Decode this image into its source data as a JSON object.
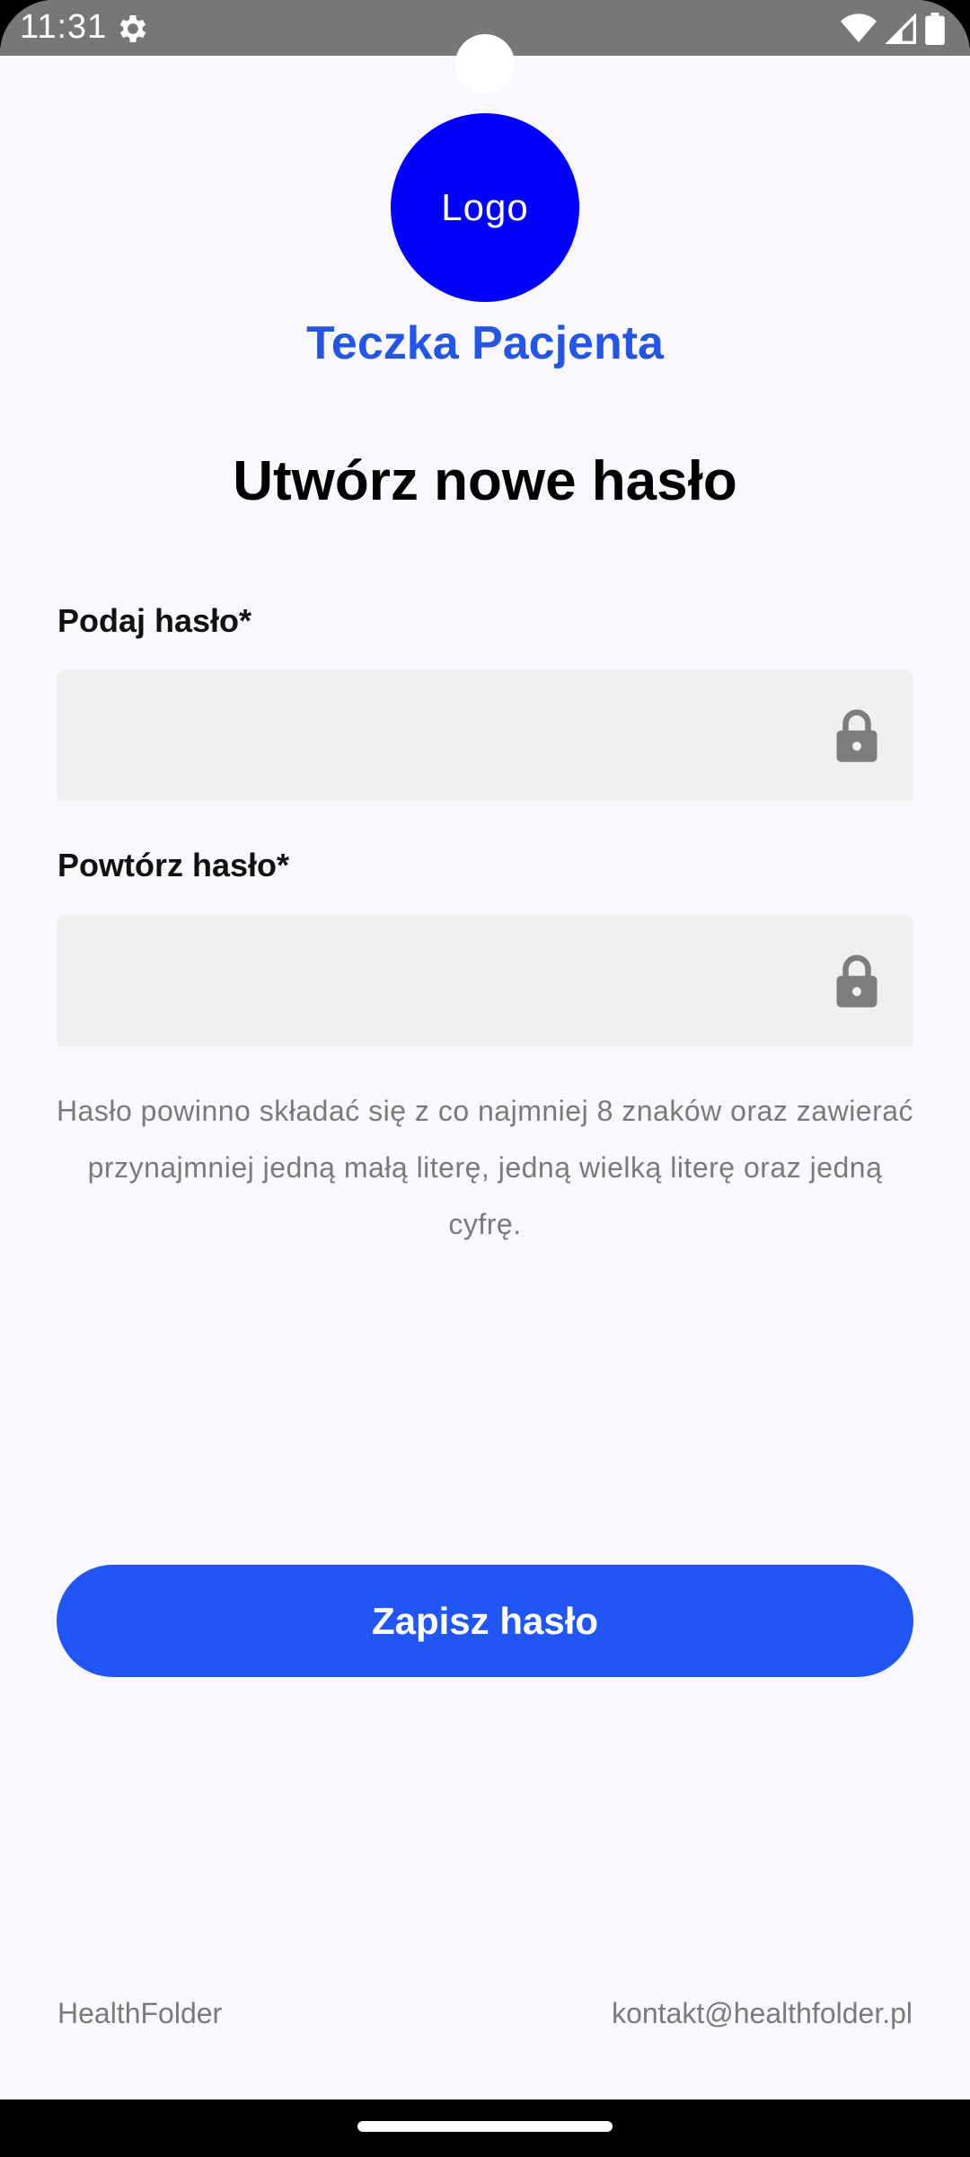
{
  "status_bar": {
    "time": "11:31",
    "icons": [
      "gear-icon",
      "wifi-icon",
      "signal-icon",
      "battery-icon"
    ]
  },
  "logo": {
    "label": "Logo",
    "color": "#0000ff"
  },
  "app": {
    "name": "Teczka Pacjenta",
    "name_color": "#2456e6"
  },
  "page": {
    "title": "Utwórz nowe hasło"
  },
  "form": {
    "password": {
      "label": "Podaj hasło*",
      "value": "",
      "placeholder": "",
      "icon": "lock-icon"
    },
    "repeat_password": {
      "label": "Powtórz hasło*",
      "value": "",
      "placeholder": "",
      "icon": "lock-icon"
    },
    "hint": "Hasło powinno składać się z co najmniej 8 znaków oraz zawierać przynajmniej jedną małą literę, jedną wielką literę oraz jedną cyfrę."
  },
  "actions": {
    "save_label": "Zapisz hasło",
    "save_color": "#2156f5"
  },
  "footer": {
    "brand": "HealthFolder",
    "email": "kontakt@healthfolder.pl"
  }
}
